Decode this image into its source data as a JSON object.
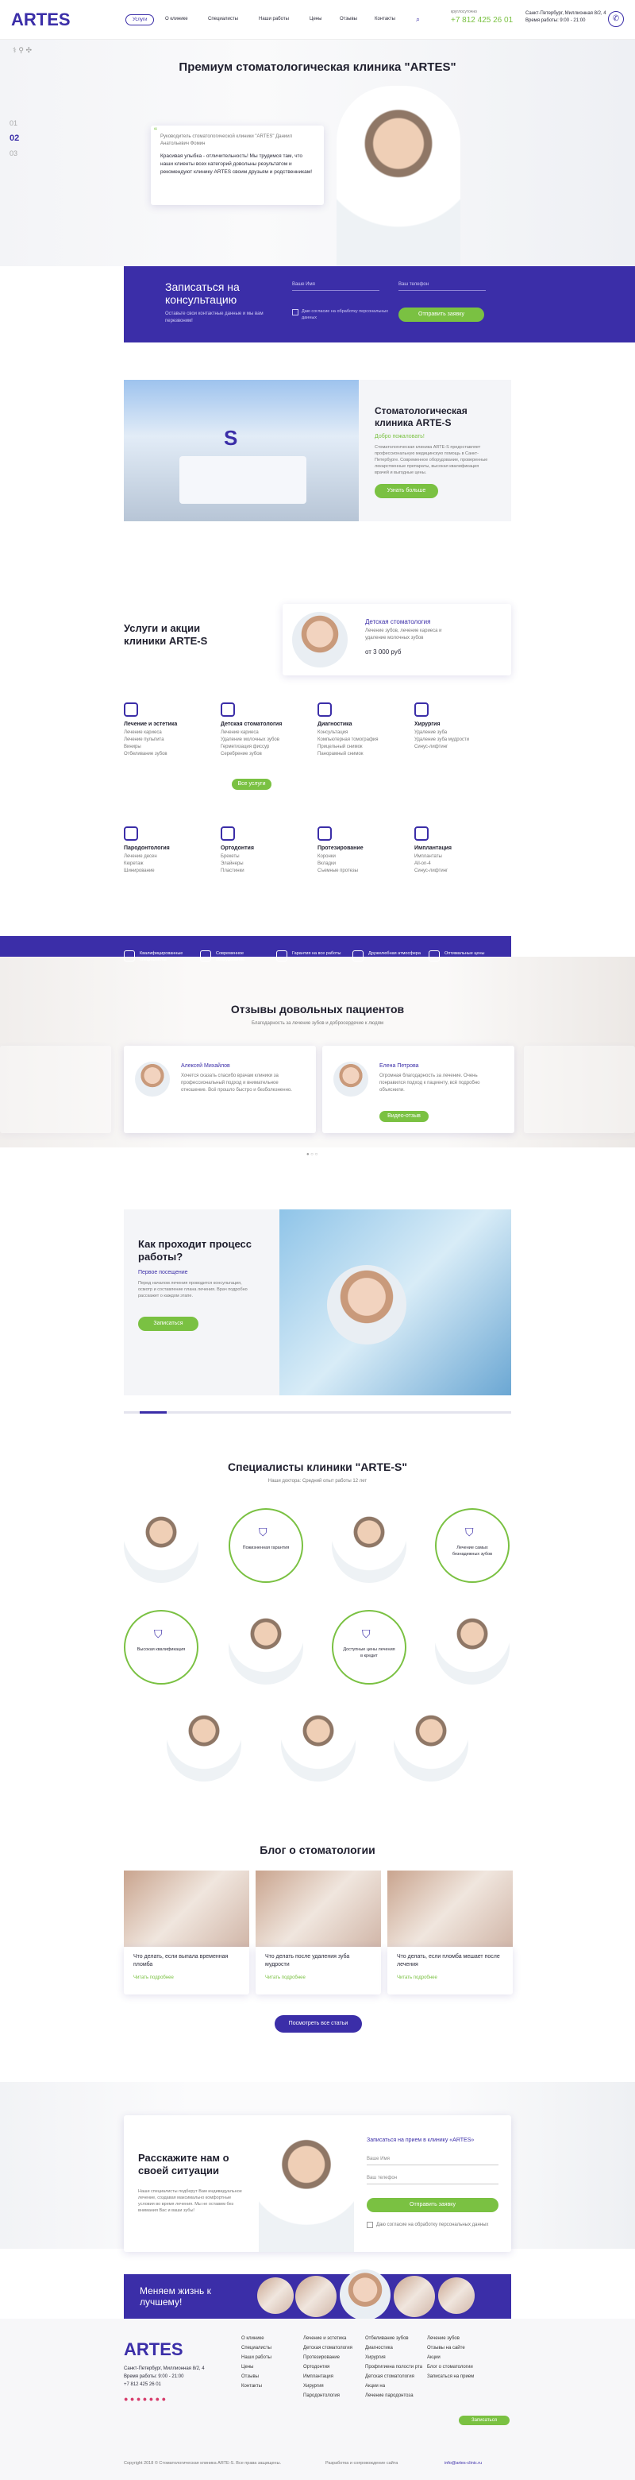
{
  "header": {
    "logo": "ARTE",
    "nav": [
      "Услуги",
      "О клинике",
      "Специалисты",
      "Наши работы",
      "Цены",
      "Отзывы",
      "Контакты"
    ],
    "phone_label": "круглосуточно",
    "phone": "+7 812 425 26 01",
    "address": "Санкт-Петербург, Миллионная 8/2, 4",
    "hours": "Время работы: 9:00 - 21:00"
  },
  "hero": {
    "title": "Премиум стоматологическая клиника \"ARTES\"",
    "quote_author": "Руководитель стоматологической клиники \"ARTES\" Даниил Анатольевич Фомин",
    "quote": "Красивая улыбка - отличительность! Мы трудимся там, что наши клиенты всех категорий довольны результатом и рекомендуют клинику ARTES своим друзьям и родственникам!",
    "slides": [
      "01",
      "02",
      "03"
    ]
  },
  "booking": {
    "title": "Записаться на консультацию",
    "text": "Оставьте свои контактные данные и мы вам перезвоним!",
    "name_ph": "Ваше Имя",
    "phone_ph": "Ваш телефон",
    "consent": "Даю согласие на обработку персональных данных",
    "button": "Отправить заявку"
  },
  "about": {
    "title": "Стоматологическая клиника ARTE-S",
    "subtitle": "Добро пожаловать!",
    "text": "Стоматологическая клиника ARTE-S предоставляет профессиональную медицинскую помощь в Санкт-Петербурге. Современное оборудование, проверенные лекарственные препараты, высокая квалификация врачей и выгодные цены.",
    "button": "Узнать больше"
  },
  "services": {
    "title": "Услуги и акции клиники ARTE-S",
    "promo_title": "Детская стоматология",
    "promo_text": "Лечение зубов, лечение кариеса и удаление молочных зубов",
    "promo_price": "от 3 000 руб",
    "button": "Все услуги",
    "items": [
      {
        "name": "Лечение и эстетика",
        "lines": [
          "Лечение кариеса",
          "Лечение пульпита",
          "Виниры",
          "Отбеливание зубов"
        ]
      },
      {
        "name": "Детская стоматология",
        "lines": [
          "Лечение кариеса",
          "Удаление молочных зубов",
          "Герметизация фиссур",
          "Серебрение зубов"
        ]
      },
      {
        "name": "Диагностика",
        "lines": [
          "Консультация",
          "Компьютерная томография",
          "Прицельный снимок",
          "Панорамный снимок"
        ]
      },
      {
        "name": "Хирургия",
        "lines": [
          "Удаление зуба",
          "Удаление зуба мудрости",
          "Синус-лифтинг"
        ]
      },
      {
        "name": "Пародонтология",
        "lines": [
          "Лечение десен",
          "Кюретаж",
          "Шинирование"
        ]
      },
      {
        "name": "Ортодонтия",
        "lines": [
          "Брекеты",
          "Элайнеры",
          "Пластинки"
        ]
      },
      {
        "name": "Протезирование",
        "lines": [
          "Коронки",
          "Вкладки",
          "Съемные протезы"
        ]
      },
      {
        "name": "Имплантация",
        "lines": [
          "Имплантаты",
          "All-on-4",
          "Синус-лифтинг"
        ]
      }
    ]
  },
  "features": [
    "Квалифицированные специалисты",
    "Современное оборудование",
    "Гарантия на все работы",
    "Дружелюбная атмосфера",
    "Оптимальные цены"
  ],
  "reviews": {
    "title": "Отзывы довольных пациентов",
    "subtitle": "Благодарность за лечение зубов и добросердечие к людям",
    "items": [
      {
        "name": "Алексей Михайлов",
        "text": "Хочется сказать спасибо врачам клиники за профессиональный подход и внимательное отношение. Всё прошло быстро и безболезненно."
      },
      {
        "name": "Елена Петрова",
        "text": "Огромная благодарность за лечение. Очень понравился подход к пациенту, всё подробно объяснили.",
        "link": "Видео-отзыв"
      }
    ]
  },
  "process": {
    "title": "Как проходит процесс работы?",
    "step": "Первое посещение",
    "text": "Перед началом лечения проводится консультация, осмотр и составление плана лечения. Врач подробно расскажет о каждом этапе.",
    "button": "Записаться"
  },
  "specialists": {
    "title": "Специалисты клиники \"ARTE-S\"",
    "subtitle": "Наши доктора: Средний опыт работы 12 лет",
    "badges": [
      "Пожизненная гарантия",
      "Лечение самых безнадежных зубов",
      "Высокая квалификация",
      "Доступные цены лечения в кредит"
    ]
  },
  "blog": {
    "title": "Блог о стоматологии",
    "button": "Посмотреть все статьи",
    "posts": [
      {
        "title": "Что делать, если выпала временная пломба",
        "link": "Читать подробнее"
      },
      {
        "title": "Что делать после удаления зуба мудрости",
        "link": "Читать подробнее"
      },
      {
        "title": "Что делать, если пломба мешает после лечения",
        "link": "Читать подробнее"
      }
    ]
  },
  "contact": {
    "title": "Расскажите нам о своей ситуации",
    "text": "Наши специалисты подберут Вам индивидуальное лечение, создавая максимально комфортные условия во время лечения. Мы не оставим без внимания Вас и ваши зубы!",
    "form_title": "Записаться на прием в клинику «ARTES»",
    "name_ph": "Ваше Имя",
    "phone_ph": "Ваш телефон",
    "button": "Отправить заявку",
    "consent": "Даю согласие на обработку персональных данных"
  },
  "banner": {
    "title": "Меняем жизнь к лучшему!"
  },
  "footer": {
    "address": "Санкт-Петербург, Миллионная 8/2, 4",
    "hours": "Время работы: 9:00 - 21:00",
    "phone": "+7 812 425 26 01",
    "cols": [
      [
        "О клинике",
        "Специалисты",
        "Наши работы",
        "Цены",
        "Отзывы",
        "Контакты"
      ],
      [
        "Лечение и эстетика",
        "Детская стоматология",
        "Протезирование",
        "Ортодонтия",
        "Имплантация",
        "Хирургия",
        "Пародонтология"
      ],
      [
        "Отбеливание зубов",
        "Диагностика",
        "Хирургия",
        "Профгигиена полости рта",
        "Детская стоматология",
        "Акции на",
        "Лечение пародонтоза"
      ],
      [
        "Лечение зубов",
        "Отзывы на сайте",
        "Акции",
        "Блог о стоматологии",
        "Записаться на прием"
      ]
    ],
    "copyright": "Copyright 2018 © Стоматологическая клиника ARTE-S. Все права защищены.",
    "dev": "Разработка и сопровождение сайта",
    "email": "info@artes-clinic.ru",
    "cta": "Записаться"
  }
}
